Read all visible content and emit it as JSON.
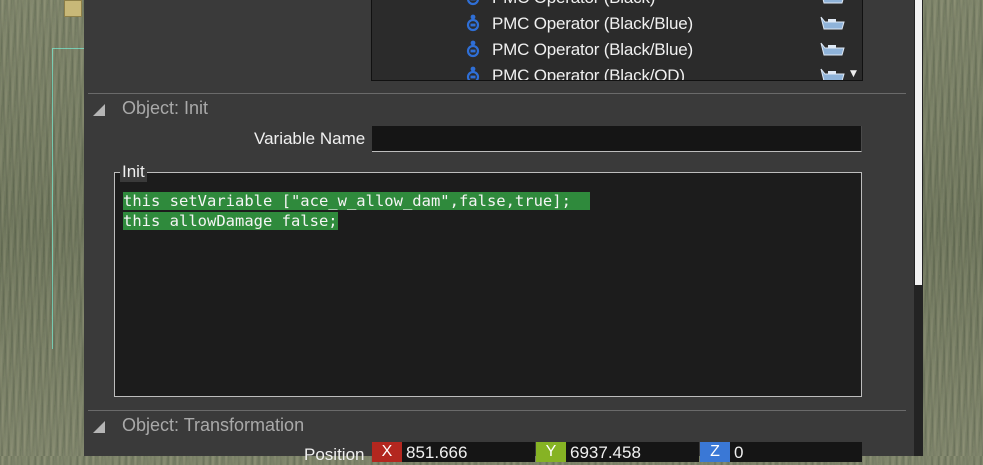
{
  "colors": {
    "panel_bg": "#3a3a3a",
    "code_highlight": "#2f8a3c",
    "axis_x": "#b3271f",
    "axis_y": "#86b324",
    "axis_z": "#3a78d6"
  },
  "unit_list": {
    "items": [
      {
        "name": "PMC Operator (Black)",
        "icon": "infantry-icon",
        "side_icon": "vehicle-icon"
      },
      {
        "name": "PMC Operator (Black/Blue)",
        "icon": "infantry-icon",
        "side_icon": "vehicle-icon"
      },
      {
        "name": "PMC Operator (Black/Blue)",
        "icon": "infantry-icon",
        "side_icon": "vehicle-icon"
      },
      {
        "name": "PMC Operator (Black/OD)",
        "icon": "infantry-icon",
        "side_icon": "vehicle-icon"
      }
    ],
    "scroll_arrow": "▼"
  },
  "sections": {
    "init": {
      "title": "Object: Init",
      "variable_name_label": "Variable Name",
      "variable_name_value": "",
      "init_label": "Init",
      "code_lines": [
        "this setVariable [\"ace_w_allow_dam\",false,true];  ",
        "this allowDamage false;"
      ]
    },
    "transformation": {
      "title": "Object: Transformation",
      "position_label": "Position",
      "position": {
        "x_label": "X",
        "x_value": "851.666",
        "y_label": "Y",
        "y_value": "6937.458",
        "z_label": "Z",
        "z_value": "0"
      }
    }
  }
}
